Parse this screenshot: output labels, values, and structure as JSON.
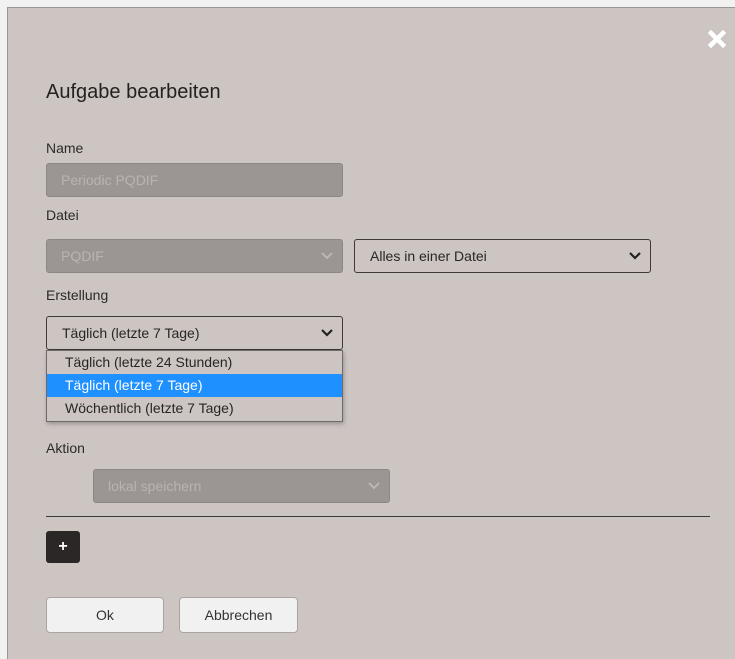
{
  "dialog": {
    "title": "Aufgabe bearbeiten",
    "close_icon": "close-x-icon"
  },
  "name": {
    "label": "Name",
    "value": "Periodic PQDIF"
  },
  "datei": {
    "label": "Datei",
    "format_value": "PQDIF",
    "mode_value": "Alles in einer Datei"
  },
  "erstellung": {
    "label": "Erstellung",
    "selected": "Täglich (letzte 7 Tage)",
    "options": [
      "Täglich (letzte 24 Stunden)",
      "Täglich (letzte 7 Tage)",
      "Wöchentlich (letzte 7 Tage)"
    ],
    "highlighted_index": 1
  },
  "aktion": {
    "label": "Aktion",
    "value": "lokal speichern"
  },
  "buttons": {
    "add": "+",
    "ok": "Ok",
    "cancel": "Abbrechen"
  },
  "colors": {
    "dialog_bg": "#cdc5c2",
    "highlight": "#1e90ff",
    "disabled_bg": "#9b9593"
  }
}
